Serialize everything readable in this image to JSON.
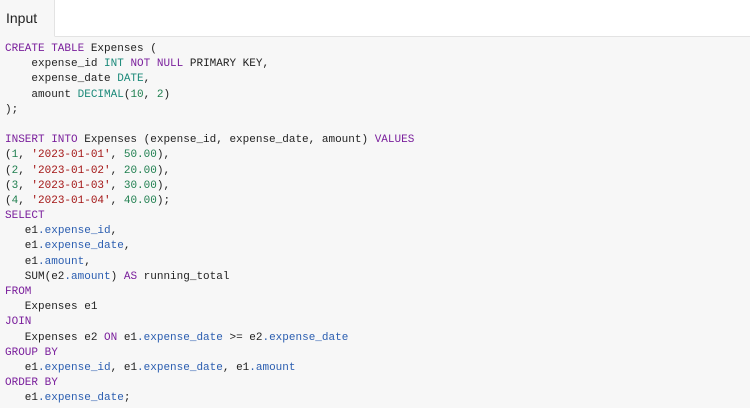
{
  "tabs": {
    "input_label": "Input"
  },
  "colors": {
    "keyword": "#7a1f9c",
    "type": "#1c8a7a",
    "string": "#a31515",
    "number": "#1f7f4f",
    "property": "#2a5db0",
    "plain": "#1f1f1f"
  },
  "code_lines": [
    [
      [
        "kw",
        "CREATE TABLE"
      ],
      [
        "t",
        " Expenses "
      ],
      [
        "t",
        "("
      ]
    ],
    [
      [
        "t",
        "    expense_id "
      ],
      [
        "ty",
        "INT"
      ],
      [
        "t",
        " "
      ],
      [
        "kw",
        "NOT NULL"
      ],
      [
        "t",
        " PRIMARY KEY,"
      ]
    ],
    [
      [
        "t",
        "    expense_date "
      ],
      [
        "ty",
        "DATE"
      ],
      [
        "t",
        ","
      ]
    ],
    [
      [
        "t",
        "    amount "
      ],
      [
        "ty",
        "DECIMAL"
      ],
      [
        "t",
        "("
      ],
      [
        "num",
        "10"
      ],
      [
        "t",
        ", "
      ],
      [
        "num",
        "2"
      ],
      [
        "t",
        ")"
      ]
    ],
    [
      [
        "t",
        ");"
      ]
    ],
    [
      [
        "t",
        ""
      ]
    ],
    [
      [
        "kw",
        "INSERT INTO"
      ],
      [
        "t",
        " Expenses (expense_id, expense_date, amount) "
      ],
      [
        "kw",
        "VALUES"
      ]
    ],
    [
      [
        "t",
        "("
      ],
      [
        "num",
        "1"
      ],
      [
        "t",
        ", "
      ],
      [
        "str",
        "'2023-01-01'"
      ],
      [
        "t",
        ", "
      ],
      [
        "num",
        "50.00"
      ],
      [
        "t",
        "),"
      ]
    ],
    [
      [
        "t",
        "("
      ],
      [
        "num",
        "2"
      ],
      [
        "t",
        ", "
      ],
      [
        "str",
        "'2023-01-02'"
      ],
      [
        "t",
        ", "
      ],
      [
        "num",
        "20.00"
      ],
      [
        "t",
        "),"
      ]
    ],
    [
      [
        "t",
        "("
      ],
      [
        "num",
        "3"
      ],
      [
        "t",
        ", "
      ],
      [
        "str",
        "'2023-01-03'"
      ],
      [
        "t",
        ", "
      ],
      [
        "num",
        "30.00"
      ],
      [
        "t",
        "),"
      ]
    ],
    [
      [
        "t",
        "("
      ],
      [
        "num",
        "4"
      ],
      [
        "t",
        ", "
      ],
      [
        "str",
        "'2023-01-04'"
      ],
      [
        "t",
        ", "
      ],
      [
        "num",
        "40.00"
      ],
      [
        "t",
        ");"
      ]
    ],
    [
      [
        "kw",
        "SELECT"
      ]
    ],
    [
      [
        "t",
        "   e1"
      ],
      [
        "prop",
        ".expense_id"
      ],
      [
        "t",
        ","
      ]
    ],
    [
      [
        "t",
        "   e1"
      ],
      [
        "prop",
        ".expense_date"
      ],
      [
        "t",
        ","
      ]
    ],
    [
      [
        "t",
        "   e1"
      ],
      [
        "prop",
        ".amount"
      ],
      [
        "t",
        ","
      ]
    ],
    [
      [
        "t",
        "   SUM(e2"
      ],
      [
        "prop",
        ".amount"
      ],
      [
        "t",
        ") "
      ],
      [
        "kw",
        "AS"
      ],
      [
        "t",
        " running_total"
      ]
    ],
    [
      [
        "kw",
        "FROM"
      ]
    ],
    [
      [
        "t",
        "   Expenses e1"
      ]
    ],
    [
      [
        "kw",
        "JOIN"
      ]
    ],
    [
      [
        "t",
        "   Expenses e2 "
      ],
      [
        "kw",
        "ON"
      ],
      [
        "t",
        " e1"
      ],
      [
        "prop",
        ".expense_date"
      ],
      [
        "t",
        " >= e2"
      ],
      [
        "prop",
        ".expense_date"
      ]
    ],
    [
      [
        "kw",
        "GROUP BY"
      ]
    ],
    [
      [
        "t",
        "   e1"
      ],
      [
        "prop",
        ".expense_id"
      ],
      [
        "t",
        ", e1"
      ],
      [
        "prop",
        ".expense_date"
      ],
      [
        "t",
        ", e1"
      ],
      [
        "prop",
        ".amount"
      ]
    ],
    [
      [
        "kw",
        "ORDER BY"
      ]
    ],
    [
      [
        "t",
        "   e1"
      ],
      [
        "prop",
        ".expense_date"
      ],
      [
        "t",
        ";"
      ]
    ]
  ]
}
